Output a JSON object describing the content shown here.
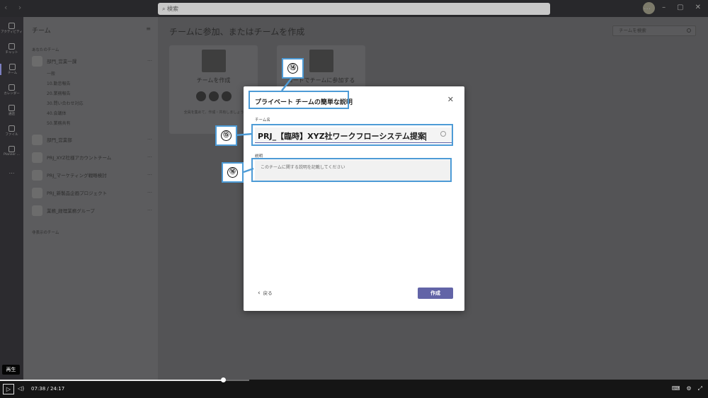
{
  "titlebar": {
    "search_placeholder": "検索",
    "nav_arrows": "‹ ›",
    "window_controls": [
      "…",
      "–",
      "▢",
      "✕"
    ]
  },
  "rail": [
    {
      "label": "アクティビティ",
      "icon": "bell-icon"
    },
    {
      "label": "チャット",
      "icon": "chat-icon"
    },
    {
      "label": "チーム",
      "icon": "teams-icon",
      "active": true
    },
    {
      "label": "カレンダー",
      "icon": "calendar-icon"
    },
    {
      "label": "通話",
      "icon": "phone-icon"
    },
    {
      "label": "ファイル",
      "icon": "file-icon"
    },
    {
      "label": "Planner ...",
      "icon": "planner-icon"
    }
  ],
  "rail_more": "…",
  "teams_pane": {
    "title": "チーム",
    "filter_icon": "filter-icon",
    "your_teams_label": "あなたのチーム",
    "teams": [
      {
        "name": "部門_営業一課",
        "channels": [
          "一般",
          "10.勤怠報告",
          "20.業務報告",
          "30.問い合わせ対応",
          "40.会議体",
          "50.業務共有"
        ]
      },
      {
        "name": "部門_営業部",
        "channels": []
      },
      {
        "name": "PRJ_XYZ社様アカウントチーム",
        "channels": []
      },
      {
        "name": "PRJ_マーケティング戦略検討",
        "channels": []
      },
      {
        "name": "PRJ_新製品企画プロジェクト",
        "channels": []
      },
      {
        "name": "業務_経理業務グループ",
        "channels": []
      }
    ],
    "hidden_teams_label": "非表示のチーム",
    "more_glyph": "…"
  },
  "main": {
    "title": "チームに参加、またはチームを作成",
    "team_search_placeholder": "チームを検索",
    "cards": [
      {
        "title": "チームを作成",
        "desc": "全員を集めて、作成・共有しましょう"
      },
      {
        "title": "コードでチームに参加する",
        "desc": ""
      }
    ]
  },
  "dialog": {
    "title": "プライベート チームの簡単な説明",
    "close_glyph": "✕",
    "name_label": "チーム名",
    "name_value": "PRJ_【臨時】XYZ社ワークフローシステム提案",
    "desc_label": "説明",
    "desc_placeholder": "このチームに関する説明を記載してください",
    "back_label": "戻る",
    "back_glyph": "‹",
    "create_label": "作成"
  },
  "callouts": [
    {
      "number": "⑭",
      "target": "dialog-title"
    },
    {
      "number": "⑮",
      "target": "team-name-input"
    },
    {
      "number": "⑯",
      "target": "description-input"
    }
  ],
  "player": {
    "tooltip": "再生",
    "time_current": "07:38",
    "time_separator": "/",
    "time_total": "24:17",
    "progress_fraction": 0.3146,
    "play_glyph": "▷",
    "volume_glyph": "◁)",
    "right_controls": [
      "⌨",
      "⚙",
      "⤢"
    ]
  },
  "colors": {
    "accent": "#6264a7",
    "callout": "#4d9bd6",
    "overlay": "#545456"
  }
}
